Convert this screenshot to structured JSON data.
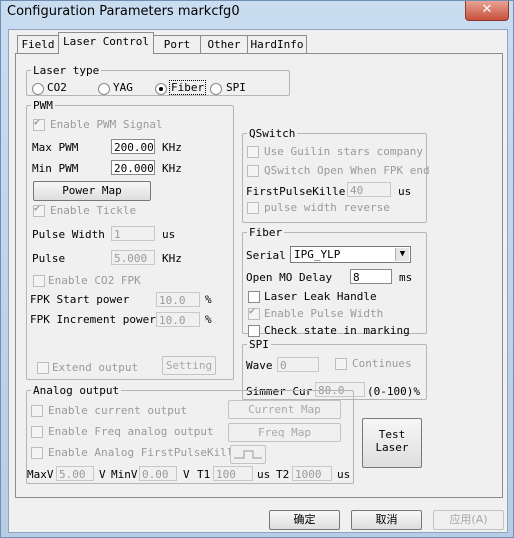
{
  "window": {
    "title": "Configuration Parameters markcfg0",
    "close_glyph": "✕"
  },
  "tabs": [
    "Field",
    "Laser Control",
    "Port",
    "Other",
    "HardInfo"
  ],
  "laser_type": {
    "label": "Laser type",
    "options": [
      "CO2",
      "YAG",
      "Fiber",
      "SPI"
    ],
    "selected": "Fiber"
  },
  "pwm": {
    "label": "PWM",
    "enable_pwm_signal": "Enable PWM Signal",
    "max_pwm_label": "Max PWM",
    "max_pwm_value": "200.000",
    "max_pwm_unit": "KHz",
    "min_pwm_label": "Min PWM",
    "min_pwm_value": "20.0000",
    "min_pwm_unit": "KHz",
    "power_map_button": "Power Map",
    "enable_tickle": "Enable Tickle",
    "pulse_width_label": "Pulse Width",
    "pulse_width_value": "1",
    "pulse_width_unit": "us",
    "pulse_label": "Pulse",
    "pulse_value": "5.000",
    "pulse_unit": "KHz",
    "enable_co2_fpk": "Enable CO2 FPK",
    "fpk_start_label": "FPK Start power",
    "fpk_start_value": "10.0",
    "fpk_start_unit": "%",
    "fpk_inc_label": "FPK Increment power",
    "fpk_inc_value": "10.0",
    "fpk_inc_unit": "%",
    "extend_output": "Extend output",
    "setting_button": "Setting"
  },
  "qswitch": {
    "label": "QSwitch",
    "guilin": "Use Guilin stars company",
    "open_when_fpk": "QSwitch Open When FPK end",
    "first_pulse_killer_label": "FirstPulseKiller",
    "first_pulse_killer_value": "40",
    "first_pulse_killer_unit": "us",
    "pulse_width_reverse": "pulse width reverse"
  },
  "fiber": {
    "label": "Fiber",
    "serial_label": "Serial",
    "serial_value": "IPG_YLP",
    "open_mo_delay_label": "Open MO Delay",
    "open_mo_delay_value": "8",
    "open_mo_delay_unit": "ms",
    "laser_leak_handle": "Laser Leak Handle",
    "enable_pulse_width": "Enable Pulse Width",
    "check_state_in_marking": "Check state in marking"
  },
  "spi": {
    "label": "SPI",
    "wave_label": "Wave",
    "wave_value": "0",
    "continues": "Continues",
    "simmer_label": "Simmer Cur",
    "simmer_value": "80.0",
    "simmer_unit": "(0-100)%"
  },
  "analog": {
    "label": "Analog output",
    "enable_current_output": "Enable current output",
    "current_map_button": "Current Map",
    "enable_freq_analog": "Enable Freq analog output",
    "freq_map_button": "Freq Map",
    "enable_analog_fpk": "Enable Analog FirstPulseKiller",
    "maxv_label": "MaxV",
    "maxv_value": "5.00",
    "maxv_unit": "V",
    "minv_label": "MinV",
    "minv_value": "0.00",
    "minv_unit": "V",
    "t1_label": "T1",
    "t1_value": "100",
    "t1_unit": "us",
    "t2_label": "T2",
    "t2_value": "1000",
    "t2_unit": "us"
  },
  "test_laser_button": {
    "line1": "Test",
    "line2": "Laser"
  },
  "footer": {
    "ok": "确定",
    "cancel": "取消",
    "apply": "应用(A)"
  }
}
